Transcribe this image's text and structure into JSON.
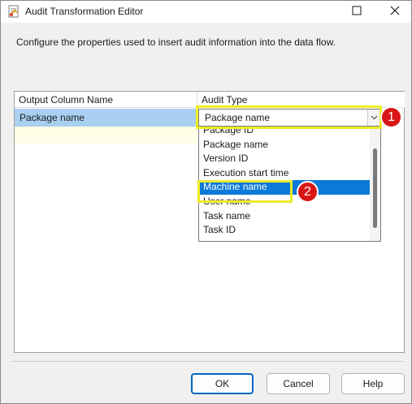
{
  "window": {
    "title": "Audit Transformation Editor",
    "icons": {
      "app": "ssis-audit-icon",
      "maximize": "maximize-icon",
      "close": "close-icon"
    }
  },
  "description": "Configure the properties used to insert audit information into the data flow.",
  "grid": {
    "headers": [
      "Output Column Name",
      "Audit Type"
    ],
    "rows": [
      {
        "output_column": "Package name",
        "audit_type": "Package name"
      }
    ]
  },
  "dropdown": {
    "options": [
      "Package ID",
      "Package name",
      "Version ID",
      "Execution start time",
      "Machine name",
      "User name",
      "Task name",
      "Task ID"
    ],
    "selected": "Machine name"
  },
  "annotations": [
    "1",
    "2"
  ],
  "colors": {
    "selection": "#0a79d7",
    "row_highlight": "#a9d0f0",
    "annotation_box": "#ecec2a",
    "badge": "#d91616",
    "primary_border": "#0067c0"
  },
  "buttons": {
    "ok": "OK",
    "cancel": "Cancel",
    "help": "Help"
  }
}
